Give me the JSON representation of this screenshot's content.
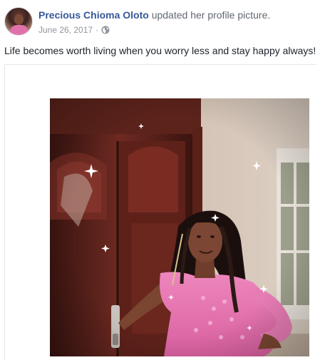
{
  "post": {
    "author": "Precious Chioma Oloto",
    "action": "updated her profile picture.",
    "date": "June 26, 2017",
    "separator": "·",
    "privacy_icon": "globe-icon",
    "text": "Life becomes worth living when you worry less and stay happy always!"
  },
  "colors": {
    "author_link": "#365899",
    "meta_text": "#90949c",
    "body_text": "#1d2129"
  }
}
